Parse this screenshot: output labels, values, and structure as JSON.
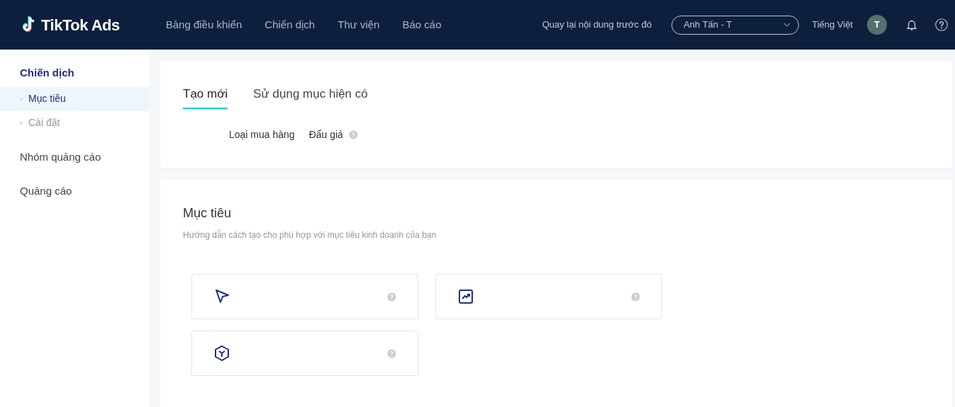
{
  "header": {
    "logo": "TikTok Ads",
    "nav": [
      {
        "label": "Bảng điều khiển"
      },
      {
        "label": "Chiến dịch"
      },
      {
        "label": "Thư viện"
      },
      {
        "label": "Báo cáo"
      }
    ],
    "back_link": "Quay lại nội dung trước đó",
    "account": "Anh Tấn - T",
    "language": "Tiếng Việt",
    "avatar": "T"
  },
  "sidebar": {
    "items": [
      {
        "label": "Chiến dịch",
        "selected": false,
        "children": [
          {
            "label": "Mục tiêu",
            "selected": true
          },
          {
            "label": "Cài đặt",
            "selected": false
          }
        ]
      },
      {
        "label": "Nhóm quảng cáo",
        "selected": false
      },
      {
        "label": "Quảng cáo",
        "selected": false
      }
    ]
  },
  "tabs": [
    {
      "label": "Tạo mới",
      "selected": true
    },
    {
      "label": "Sử dụng mục hiện có",
      "selected": false
    }
  ],
  "buying_type": {
    "label": "Loại mua hàng",
    "value": "Đấu giá"
  },
  "objective": {
    "title": "Mục tiêu",
    "subtitle": "Hướng dẫn cách tạo cho phù hợp với mục tiêu kinh doanh của bạn",
    "options": [
      {
        "kind": "cursor"
      },
      {
        "kind": "chart"
      },
      {
        "kind": "cube"
      }
    ]
  }
}
